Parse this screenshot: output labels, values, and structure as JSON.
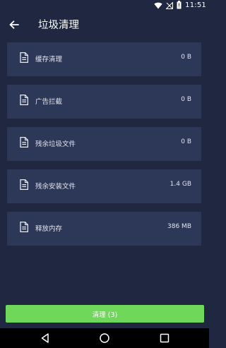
{
  "status_bar": {
    "time": "11:51",
    "icons": [
      "wifi-icon",
      "signal-off-icon",
      "battery-icon"
    ]
  },
  "header": {
    "back_icon": "arrow-left-icon",
    "title": "垃圾清理"
  },
  "items": [
    {
      "label": "缓存清理",
      "value": "0 B",
      "icon": "document-icon"
    },
    {
      "label": "广告拦截",
      "value": "0 B",
      "icon": "document-icon"
    },
    {
      "label": "残余垃圾文件",
      "value": "0 B",
      "icon": "document-icon"
    },
    {
      "label": "残余安装文件",
      "value": "1.4 GB",
      "icon": "document-icon"
    },
    {
      "label": "释放内存",
      "value": "386 MB",
      "icon": "document-icon"
    }
  ],
  "action": {
    "clean_label": "清理 (3)"
  },
  "nav_bar": {
    "icons": [
      "back-triangle-icon",
      "home-circle-icon",
      "recents-square-icon"
    ]
  },
  "colors": {
    "background": "#1f2741",
    "card": "#2d3757",
    "accent_green": "#6fd75a",
    "nav_bar": "#000000"
  }
}
